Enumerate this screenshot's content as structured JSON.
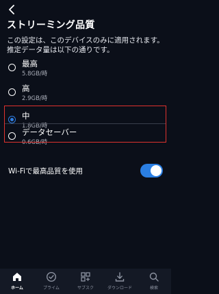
{
  "header": {
    "back_icon": "chevron-left-icon",
    "title": "ストリーミング品質"
  },
  "description": "この設定は、このデバイスのみに適用されます。推定データ量は以下の通りです。",
  "quality_options": [
    {
      "label": "最高",
      "data_rate": "5.8GB/時",
      "selected": false
    },
    {
      "label": "高",
      "data_rate": "2.9GB/時",
      "selected": false
    },
    {
      "label": "中",
      "data_rate": "1.8GB/時",
      "selected": true
    },
    {
      "label": "データセーバー",
      "data_rate": "0.6GB/時",
      "selected": false
    }
  ],
  "wifi_setting": {
    "label": "Wi-Fiで最高品質を使用",
    "enabled": true
  },
  "bottom_nav": [
    {
      "label": "ホーム",
      "icon": "home-icon",
      "active": true
    },
    {
      "label": "プライム",
      "icon": "check-circle-icon",
      "active": false
    },
    {
      "label": "サブスク",
      "icon": "subscriptions-grid-icon",
      "active": false
    },
    {
      "label": "ダウンロード",
      "icon": "download-icon",
      "active": false
    },
    {
      "label": "検索",
      "icon": "search-icon",
      "active": false
    }
  ],
  "colors": {
    "background": "#0b0f19",
    "accent": "#2f7de1",
    "highlight_border": "#e0322e",
    "nav_background": "#141925"
  }
}
